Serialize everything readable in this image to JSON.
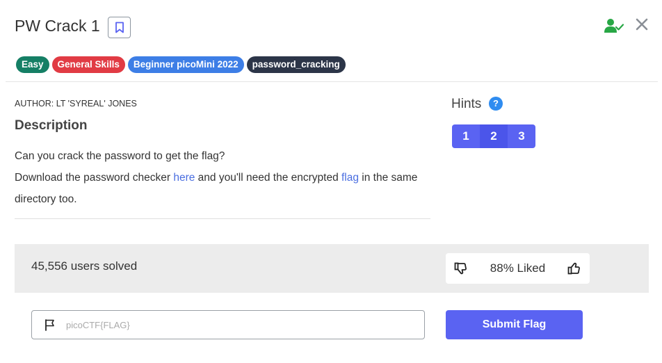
{
  "challenge": {
    "title": "PW Crack 1",
    "tags": [
      {
        "label": "Easy",
        "color": "#157f65"
      },
      {
        "label": "General Skills",
        "color": "#e13b44"
      },
      {
        "label": "Beginner picoMini 2022",
        "color": "#3d7ee6"
      },
      {
        "label": "password_cracking",
        "color": "#2c3548"
      }
    ],
    "author": "AUTHOR: LT 'SYREAL' JONES",
    "description_heading": "Description",
    "description": {
      "line1": "Can you crack the password to get the flag?",
      "line2_prefix": "Download the password checker ",
      "link1": "here",
      "line2_middle": " and you'll need the encrypted ",
      "link2": "flag",
      "line2_suffix": " in the same directory too."
    }
  },
  "hints": {
    "label": "Hints",
    "help_icon": "?",
    "buttons": [
      "1",
      "2",
      "3"
    ]
  },
  "stats": {
    "solved": "45,556 users solved",
    "liked": "88% Liked"
  },
  "flag_form": {
    "placeholder": "picoCTF{FLAG}",
    "value": "",
    "submit_label": "Submit Flag"
  },
  "icons": {
    "bookmark": "bookmark-icon",
    "user_check": "user-check-icon",
    "close": "close-icon",
    "thumbs_down": "thumbs-down-icon",
    "thumbs_up": "thumbs-up-icon",
    "flag": "flag-icon"
  },
  "colors": {
    "accent": "#5a63f2",
    "link": "#4a6ee0",
    "success": "#28a745"
  }
}
